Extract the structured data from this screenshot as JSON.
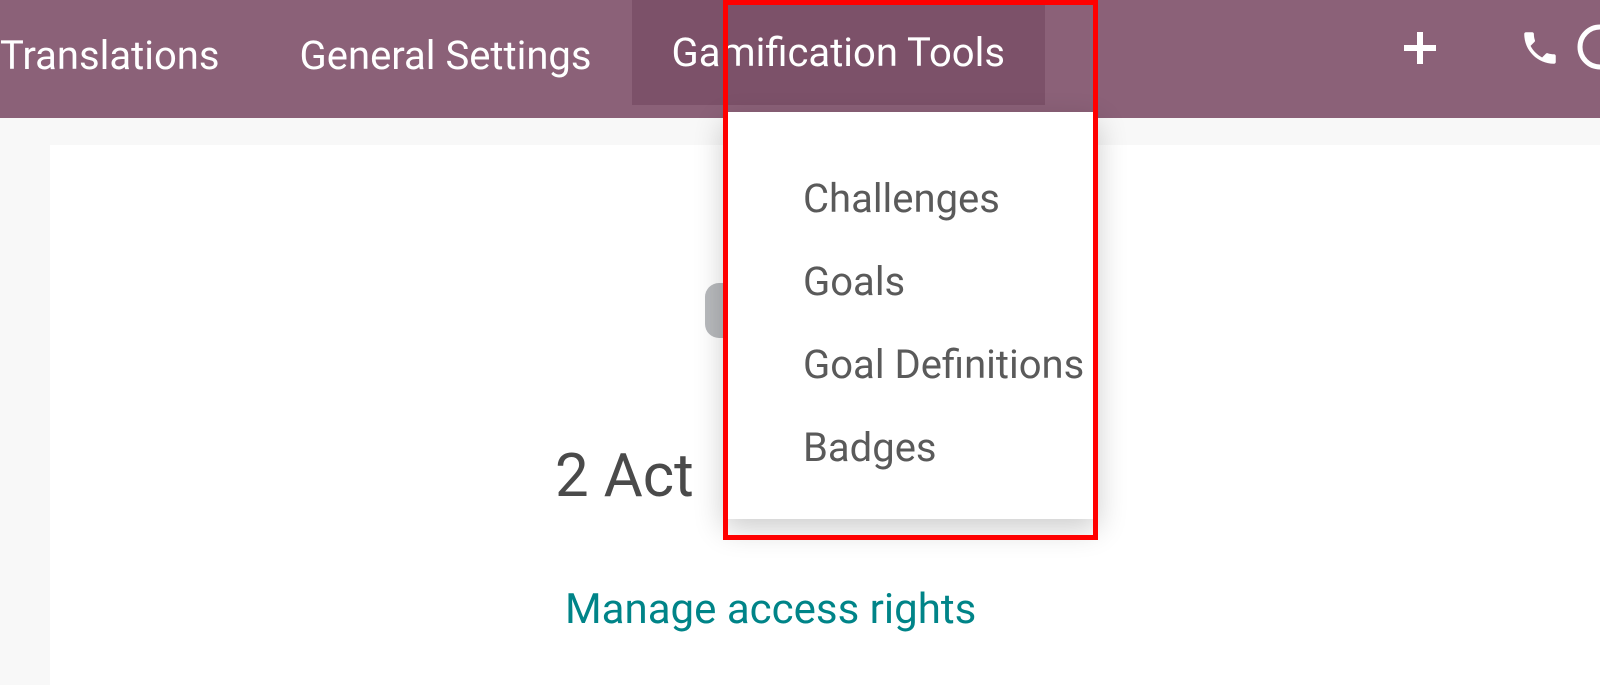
{
  "navbar": {
    "items": [
      {
        "label": "Translations"
      },
      {
        "label": "General Settings"
      },
      {
        "label": "Gamification Tools"
      }
    ]
  },
  "dropdown": {
    "items": [
      {
        "label": "Challenges"
      },
      {
        "label": "Goals"
      },
      {
        "label": "Goal Definitions"
      },
      {
        "label": "Badges"
      }
    ]
  },
  "content": {
    "title_fragment": "2 Act",
    "manage_link": "Manage access rights"
  }
}
